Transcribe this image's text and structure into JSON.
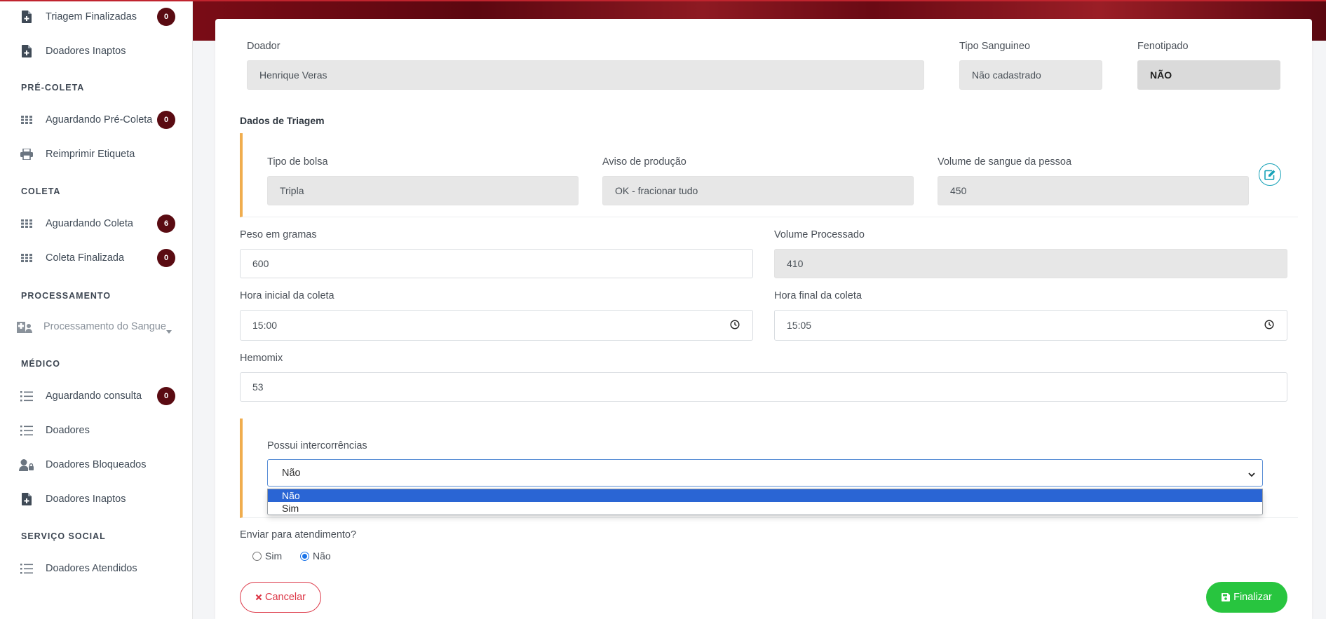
{
  "sidebar": {
    "items": [
      {
        "label": "Triagem Finalizadas",
        "badge": "0",
        "icon": "file-plus-icon"
      },
      {
        "label": "Doadores Inaptos",
        "icon": "file-plus-icon"
      },
      {
        "section": "PRÉ-COLETA"
      },
      {
        "label": "Aguardando Pré-Coleta",
        "badge": "0",
        "icon": "grid-icon"
      },
      {
        "label": "Reimprimir Etiqueta",
        "icon": "printer-icon"
      },
      {
        "section": "COLETA"
      },
      {
        "label": "Aguardando Coleta",
        "badge": "6",
        "icon": "grid-icon"
      },
      {
        "label": "Coleta Finalizada",
        "badge": "0",
        "icon": "grid-icon"
      },
      {
        "section": "PROCESSAMENTO"
      },
      {
        "label": "Processamento do Sangue",
        "icon": "hospital-user-icon"
      },
      {
        "section": "MÉDICO"
      },
      {
        "label": "Aguardando consulta",
        "badge": "0",
        "icon": "list-icon"
      },
      {
        "label": "Doadores",
        "icon": "list-icon"
      },
      {
        "label": "Doadores Bloqueados",
        "icon": "user-lock-icon"
      },
      {
        "label": "Doadores Inaptos",
        "icon": "file-plus-icon"
      },
      {
        "section": "SERVIÇO SOCIAL"
      },
      {
        "label": "Doadores Atendidos",
        "icon": "list-icon"
      }
    ]
  },
  "donor": {
    "doador_label": "Doador",
    "doador_value": "Henrique Veras",
    "tipo_label": "Tipo Sanguineo",
    "tipo_value": "Não cadastrado",
    "fenotipado_label": "Fenotipado",
    "fenotipado_value": "NÃO"
  },
  "triagem": {
    "title": "Dados de Triagem",
    "tipo_bolsa_label": "Tipo de bolsa",
    "tipo_bolsa_value": "Tripla",
    "aviso_label": "Aviso de produção",
    "aviso_value": "OK - fracionar tudo",
    "volume_label": "Volume de sangue da pessoa",
    "volume_value": "450"
  },
  "form": {
    "peso_label": "Peso em gramas",
    "peso_value": "600",
    "volume_proc_label": "Volume Processado",
    "volume_proc_value": "410",
    "hora_ini_label": "Hora inicial da coleta",
    "hora_ini_value": "15:00",
    "hora_fim_label": "Hora final da coleta",
    "hora_fim_value": "15:05",
    "hemomix_label": "Hemomix",
    "hemomix_value": "53"
  },
  "intercorrencias": {
    "label": "Possui intercorrências",
    "selected": "Não",
    "options": [
      "Não",
      "Sim"
    ]
  },
  "atendimento": {
    "label": "Enviar para atendimento?",
    "options": [
      "Sim",
      "Não"
    ],
    "selected": "Não"
  },
  "actions": {
    "cancel_label": "Cancelar",
    "finish_label": "Finalizar"
  },
  "colors": {
    "badge": "#5a0b12",
    "accent": "#f0ad4e",
    "cancel": "#dc3545",
    "finish": "#28c53f"
  }
}
